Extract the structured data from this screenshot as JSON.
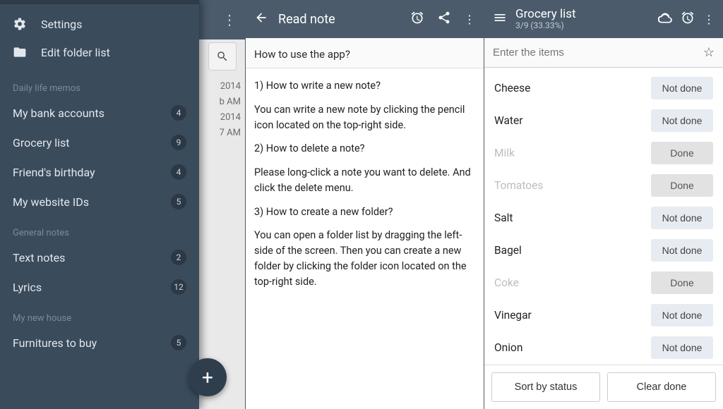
{
  "screen1": {
    "settings_label": "Settings",
    "edit_folder_label": "Edit folder list",
    "sections": [
      {
        "title": "Daily life memos",
        "folders": [
          {
            "name": "My bank accounts",
            "count": 4
          },
          {
            "name": "Grocery list",
            "count": 9
          },
          {
            "name": "Friend's birthday",
            "count": 4
          },
          {
            "name": "My website IDs",
            "count": 5
          }
        ]
      },
      {
        "title": "General notes",
        "folders": [
          {
            "name": "Text notes",
            "count": 2
          },
          {
            "name": "Lyrics",
            "count": 12
          }
        ]
      },
      {
        "title": "My new house",
        "folders": [
          {
            "name": "Furnitures to buy",
            "count": 5
          }
        ]
      }
    ],
    "peek_dates": [
      "2014",
      "b AM",
      "2014",
      "7 AM"
    ]
  },
  "screen2": {
    "appbar_title": "Read note",
    "note_title": "How to use the app?",
    "paragraphs": [
      "1) How to write a new note?",
      "You can write a new note by clicking the pencil icon located on the top-right side.",
      "2) How to delete a note?",
      "Please long-click a note you want to delete. And click the delete menu.",
      "3) How to create a new folder?",
      "You can open a folder list by dragging the left-side of the screen. Then you can create a new folder by clicking the folder icon located on the top-right side."
    ]
  },
  "screen3": {
    "title": "Grocery list",
    "subtitle": "3/9 (33.33%)",
    "input_placeholder": "Enter the items",
    "items": [
      {
        "name": "Cheese",
        "done": false,
        "label": "Not done"
      },
      {
        "name": "Water",
        "done": false,
        "label": "Not done"
      },
      {
        "name": "Milk",
        "done": true,
        "label": "Done"
      },
      {
        "name": "Tomatoes",
        "done": true,
        "label": "Done"
      },
      {
        "name": "Salt",
        "done": false,
        "label": "Not done"
      },
      {
        "name": "Bagel",
        "done": false,
        "label": "Not done"
      },
      {
        "name": "Coke",
        "done": true,
        "label": "Done"
      },
      {
        "name": "Vinegar",
        "done": false,
        "label": "Not done"
      },
      {
        "name": "Onion",
        "done": false,
        "label": "Not done"
      }
    ],
    "sort_label": "Sort by status",
    "clear_label": "Clear done"
  }
}
